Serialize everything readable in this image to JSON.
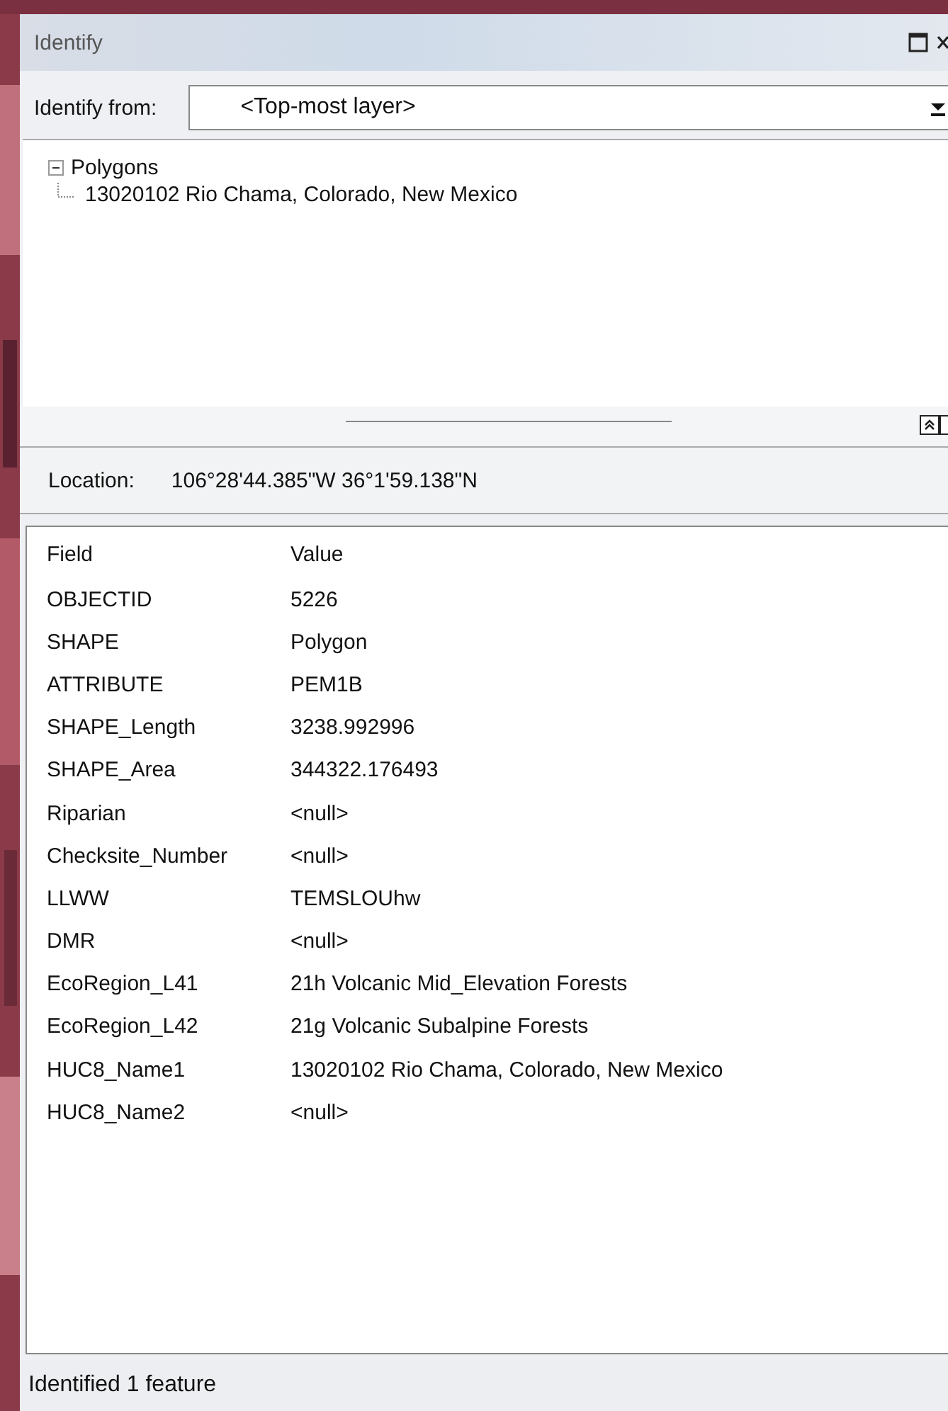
{
  "window": {
    "title": "Identify"
  },
  "identify_from": {
    "label": "Identify from:",
    "value": "<Top-most layer>"
  },
  "tree": [
    {
      "label": "Polygons",
      "expanded": true,
      "children": [
        {
          "label": "13020102  Rio Chama, Colorado, New Mexico"
        }
      ]
    }
  ],
  "location": {
    "label": "Location:",
    "value": "106°28'44.385\"W  36°1'59.138\"N"
  },
  "table": {
    "columns": [
      "Field",
      "Value"
    ],
    "rows": [
      [
        "OBJECTID",
        "5226"
      ],
      [
        "SHAPE",
        "Polygon"
      ],
      [
        "ATTRIBUTE",
        "PEM1B"
      ],
      [
        "SHAPE_Length",
        "3238.992996"
      ],
      [
        "SHAPE_Area",
        "344322.176493"
      ],
      [
        "Riparian",
        "<null>"
      ],
      [
        "Checksite_Number",
        "<null>"
      ],
      [
        "LLWW",
        "TEMSLOUhw"
      ],
      [
        "DMR",
        "<null>"
      ],
      [
        "EcoRegion_L41",
        "21h  Volcanic Mid_Elevation Forests"
      ],
      [
        "EcoRegion_L42",
        "21g  Volcanic Subalpine Forests"
      ],
      [
        "HUC8_Name1",
        "13020102  Rio Chama, Colorado, New Mexico"
      ],
      [
        "HUC8_Name2",
        "<null>"
      ]
    ]
  },
  "status_bar": "Identified 1 feature"
}
